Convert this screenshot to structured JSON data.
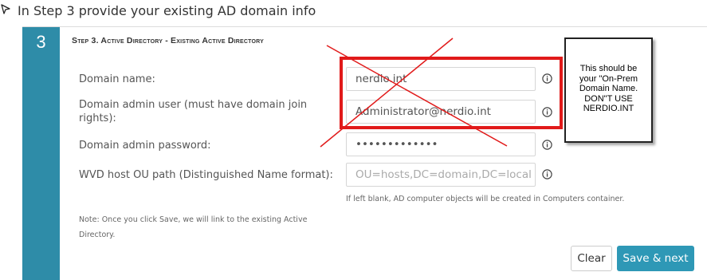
{
  "caption": {
    "text": "In Step 3 provide your existing AD domain info"
  },
  "step": {
    "number": "3",
    "title": "Step 3. Active Directory - Existing Active Directory"
  },
  "form": {
    "domain_name": {
      "label": "Domain name:",
      "value": "nerdio.int"
    },
    "admin_user": {
      "label": "Domain admin user (must have domain join rights):",
      "value": "Administrator@nerdio.int"
    },
    "admin_password": {
      "label": "Domain admin password:",
      "value": "•••••••••••••"
    },
    "ou_path": {
      "label": "WVD host OU path (Distinguished Name format):",
      "value": "",
      "placeholder": "OU=hosts,DC=domain,DC=local"
    },
    "ou_hint": "If left blank, AD computer objects will be created in Computers container.",
    "note": "Note: Once you click Save, we will link to the existing Active Directory."
  },
  "buttons": {
    "clear": "Clear",
    "save": "Save & next"
  },
  "callout": {
    "lines": [
      "This should be",
      "your \"On-Prem",
      "Domain Name.",
      "DON\"T USE",
      "NERDIO.INT"
    ]
  },
  "colors": {
    "step_bar": "#2e8ca8",
    "save_button": "#2e98b6",
    "annotation_red": "#e11a1a"
  },
  "icons": {
    "caption": "pointer-bullet-icon",
    "info": "info-circle-icon"
  }
}
